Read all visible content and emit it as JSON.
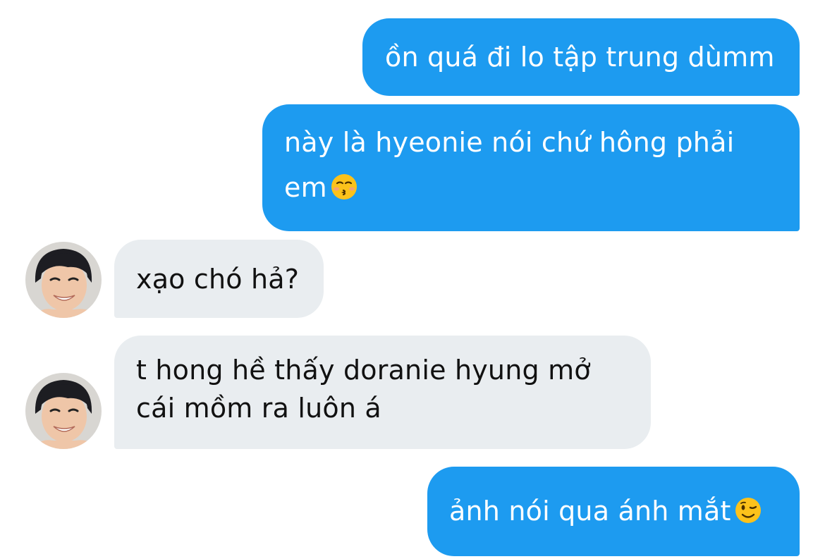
{
  "conversation": {
    "messages": [
      {
        "sender": "me",
        "lines": [
          "ồn quá đi lo tập trung dùmm"
        ]
      },
      {
        "sender": "me",
        "lines": [
          "này là hyeonie nói chứ hông phải",
          "em"
        ],
        "emoji": "kissing-closed-eyes-emoji"
      },
      {
        "sender": "other",
        "lines": [
          "xạo chó hả?"
        ],
        "avatar": "avatar-smiling-man"
      },
      {
        "sender": "other",
        "lines": [
          "t hong hề thấy doranie hyung mở",
          "cái mồm ra luôn á"
        ],
        "avatar": "avatar-smiling-man"
      },
      {
        "sender": "me",
        "lines": [
          "ảnh nói qua ánh mắt"
        ],
        "emoji": "winking-face-emoji"
      }
    ]
  },
  "colors": {
    "sent_bubble": "#1d9bf0",
    "received_bubble": "#e9edf0",
    "sent_text": "#ffffff",
    "received_text": "#111111"
  }
}
